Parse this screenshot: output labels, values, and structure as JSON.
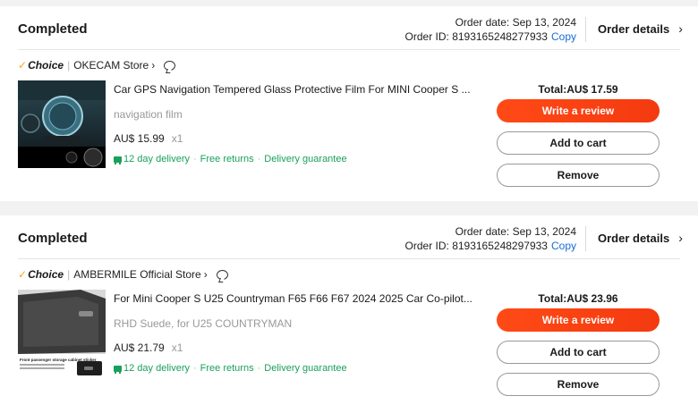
{
  "orders": [
    {
      "status": "Completed",
      "order_date": "Order date: Sep 13, 2024",
      "order_id": "Order ID: 8193165248277933",
      "copy_label": "Copy",
      "details_label": "Order details",
      "choice_label": "Choice",
      "store_name": "OKECAM Store",
      "product_title": "Car GPS Navigation Tempered Glass Protective Film For MINI Cooper S ...",
      "variant": "navigation film",
      "unit_price": "AU$ 15.99",
      "quantity": "x1",
      "delivery": "12 day delivery",
      "returns": "Free returns",
      "guarantee": "Delivery guarantee",
      "total": "Total:AU$ 17.59",
      "review_label": "Write a review",
      "cart_label": "Add to cart",
      "remove_label": "Remove"
    },
    {
      "status": "Completed",
      "order_date": "Order date: Sep 13, 2024",
      "order_id": "Order ID: 8193165248297933",
      "copy_label": "Copy",
      "details_label": "Order details",
      "choice_label": "Choice",
      "store_name": "AMBERMILE Official Store",
      "product_title": "For Mini Cooper S U25 Countryman F65 F66 F67 2024 2025 Car Co-pilot...",
      "variant": "RHD Suede, for U25 COUNTRYMAN",
      "unit_price": "AU$ 21.79",
      "quantity": "x1",
      "delivery": "12 day delivery",
      "returns": "Free returns",
      "guarantee": "Delivery guarantee",
      "total": "Total:AU$ 23.96",
      "review_label": "Write a review",
      "cart_label": "Add to cart",
      "remove_label": "Remove",
      "thumb_caption": "Front passenger storage cabinet sticker"
    }
  ],
  "icons": {
    "chevron": "chevron-right-icon",
    "chat": "chat-icon",
    "truck": "truck-icon"
  },
  "colors": {
    "accent": "#ff4a16",
    "link": "#1a6bd6",
    "success": "#19a05a",
    "choice_tick": "#f5a623"
  }
}
